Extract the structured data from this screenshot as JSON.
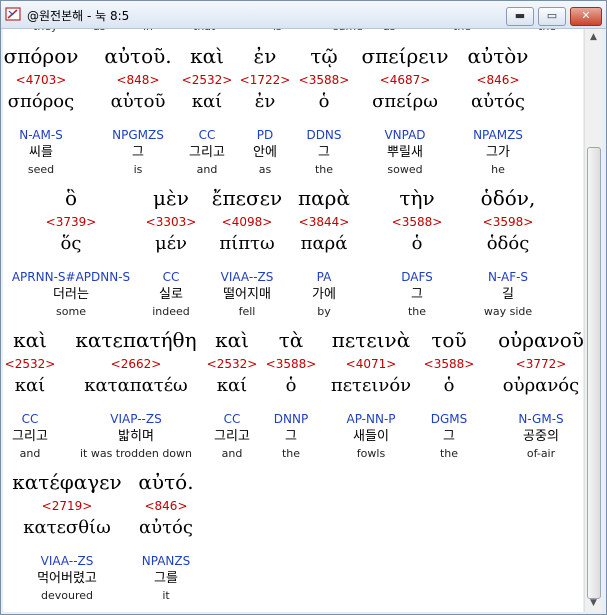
{
  "window": {
    "title": "@원전본해 - 눅 8:5",
    "app_icon": "bible-app-icon",
    "controls": {
      "minimize": "▬",
      "maximize": "▭",
      "close": "✕"
    }
  },
  "clipped_top_words": [
    "they",
    "as",
    "in",
    "that",
    "is",
    "same",
    "as",
    "the",
    "the"
  ],
  "rows": [
    {
      "words": [
        {
          "greek": "σπόρον",
          "strong": "<4703>",
          "lemma": "σπόρος",
          "parse": "N-AM-S",
          "korean": "씨를",
          "english": "seed"
        },
        {
          "greek": "αὐτοῦ.",
          "strong": "<848>",
          "lemma": "αὑτοῦ",
          "parse": "NPGMZS",
          "korean": "그",
          "english": "is"
        },
        {
          "greek": "καὶ",
          "strong": "<2532>",
          "lemma": "καί",
          "parse": "CC",
          "korean": "그리고",
          "english": "and"
        },
        {
          "greek": "ἐν",
          "strong": "<1722>",
          "lemma": "ἐν",
          "parse": "PD",
          "korean": "안에",
          "english": "as"
        },
        {
          "greek": "τῷ",
          "strong": "<3588>",
          "lemma": "ὁ",
          "parse": "DDNS",
          "korean": "그",
          "english": "the"
        },
        {
          "greek": "σπείρειν",
          "strong": "<4687>",
          "lemma": "σπείρω",
          "parse": "VNPAD",
          "korean": "뿌릴새",
          "english": "sowed"
        },
        {
          "greek": "αὐτὸν",
          "strong": "<846>",
          "lemma": "αὐτός",
          "parse": "NPAMZS",
          "korean": "그가",
          "english": "he"
        }
      ]
    },
    {
      "words": [
        {
          "greek": "ὃ",
          "strong": "<3739>",
          "lemma": "ὅς",
          "parse": "APRNN-S#APDNN-S",
          "korean": "더러는",
          "english": "some"
        },
        {
          "greek": "μὲν",
          "strong": "<3303>",
          "lemma": "μέν",
          "parse": "CC",
          "korean": "실로",
          "english": "indeed"
        },
        {
          "greek": "ἔπεσεν",
          "strong": "<4098>",
          "lemma": "πίπτω",
          "parse": "VIAA--ZS",
          "korean": "떨어지매",
          "english": "fell"
        },
        {
          "greek": "παρὰ",
          "strong": "<3844>",
          "lemma": "παρά",
          "parse": "PA",
          "korean": "가에",
          "english": "by"
        },
        {
          "greek": "τὴν",
          "strong": "<3588>",
          "lemma": "ὁ",
          "parse": "DAFS",
          "korean": "그",
          "english": "the"
        },
        {
          "greek": "ὁδόν,",
          "strong": "<3598>",
          "lemma": "ὁδός",
          "parse": "N-AF-S",
          "korean": "길",
          "english": "way side"
        }
      ]
    },
    {
      "words": [
        {
          "greek": "καὶ",
          "strong": "<2532>",
          "lemma": "καί",
          "parse": "CC",
          "korean": "그리고",
          "english": "and"
        },
        {
          "greek": "κατεπατήθη",
          "strong": "<2662>",
          "lemma": "καταπατέω",
          "parse": "VIAP--ZS",
          "korean": "밟히며",
          "english": "it was trodden down"
        },
        {
          "greek": "καὶ",
          "strong": "<2532>",
          "lemma": "καί",
          "parse": "CC",
          "korean": "그리고",
          "english": "and"
        },
        {
          "greek": "τὰ",
          "strong": "<3588>",
          "lemma": "ὁ",
          "parse": "DNNP",
          "korean": "그",
          "english": "the"
        },
        {
          "greek": "πετεινὰ",
          "strong": "<4071>",
          "lemma": "πετεινόν",
          "parse": "AP-NN-P",
          "korean": "새들이",
          "english": "fowls"
        },
        {
          "greek": "τοῦ",
          "strong": "<3588>",
          "lemma": "ὁ",
          "parse": "DGMS",
          "korean": "그",
          "english": "the"
        },
        {
          "greek": "οὐρανοῦ",
          "strong": "<3772>",
          "lemma": "οὐρανός",
          "parse": "N-GM-S",
          "korean": "공중의",
          "english": "of-air"
        }
      ]
    },
    {
      "words": [
        {
          "greek": "κατέφαγεν",
          "strong": "<2719>",
          "lemma": "κατεσθίω",
          "parse": "VIAA--ZS",
          "korean": "먹어버렸고",
          "english": "devoured"
        },
        {
          "greek": "αὐτό.",
          "strong": "<846>",
          "lemma": "αὐτός",
          "parse": "NPANZS",
          "korean": "그를",
          "english": "it"
        }
      ]
    }
  ]
}
